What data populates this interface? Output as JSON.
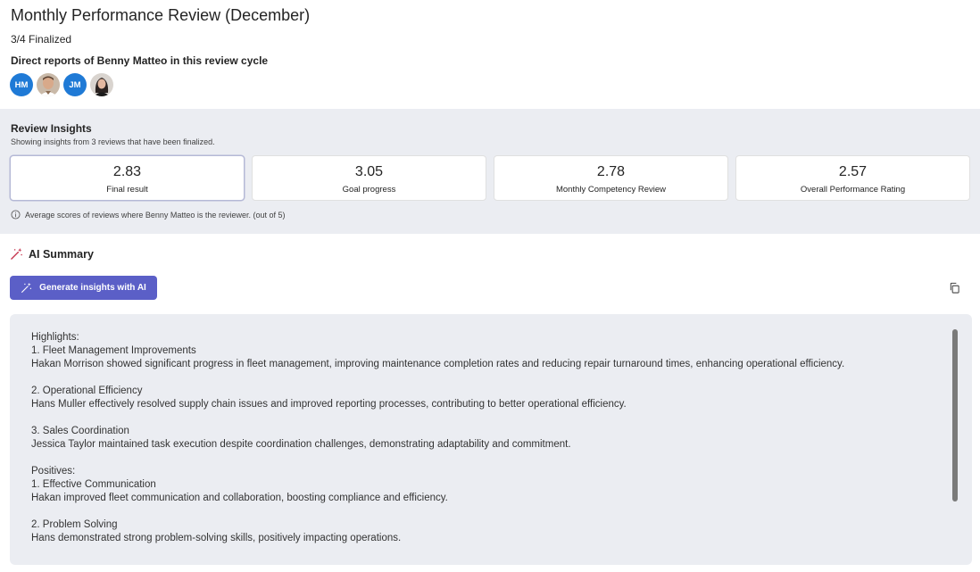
{
  "header": {
    "title": "Monthly Performance Review (December)",
    "finalized": "3/4 Finalized",
    "reports_label": "Direct reports of Benny Matteo in this review cycle",
    "avatars": [
      {
        "type": "initials",
        "text": "HM"
      },
      {
        "type": "photo",
        "icon": "person-photo-man"
      },
      {
        "type": "initials",
        "text": "JM"
      },
      {
        "type": "photo",
        "icon": "person-photo-woman"
      }
    ]
  },
  "insights": {
    "title": "Review Insights",
    "subtitle": "Showing insights from 3 reviews that have been finalized.",
    "cards": [
      {
        "value": "2.83",
        "label": "Final result"
      },
      {
        "value": "3.05",
        "label": "Goal progress"
      },
      {
        "value": "2.78",
        "label": "Monthly Competency Review"
      },
      {
        "value": "2.57",
        "label": "Overall Performance Rating"
      }
    ],
    "note": "Average scores of reviews where Benny Matteo is the reviewer. (out of 5)"
  },
  "ai": {
    "title": "AI Summary",
    "generate_label": "Generate insights with AI",
    "summary": "Highlights:\n1. Fleet Management Improvements\nHakan Morrison showed significant progress in fleet management, improving maintenance completion rates and reducing repair turnaround times, enhancing operational efficiency.\n\n2. Operational Efficiency\nHans Muller effectively resolved supply chain issues and improved reporting processes, contributing to better operational efficiency.\n\n3. Sales Coordination\nJessica Taylor maintained task execution despite coordination challenges, demonstrating adaptability and commitment.\n\nPositives:\n1. Effective Communication\nHakan improved fleet communication and collaboration, boosting compliance and efficiency.\n\n2. Problem Solving\nHans demonstrated strong problem-solving skills, positively impacting operations."
  },
  "colors": {
    "accent": "#5b5fc7",
    "avatar_blue": "#1f7ad6",
    "panel_bg": "#ebedf2"
  }
}
